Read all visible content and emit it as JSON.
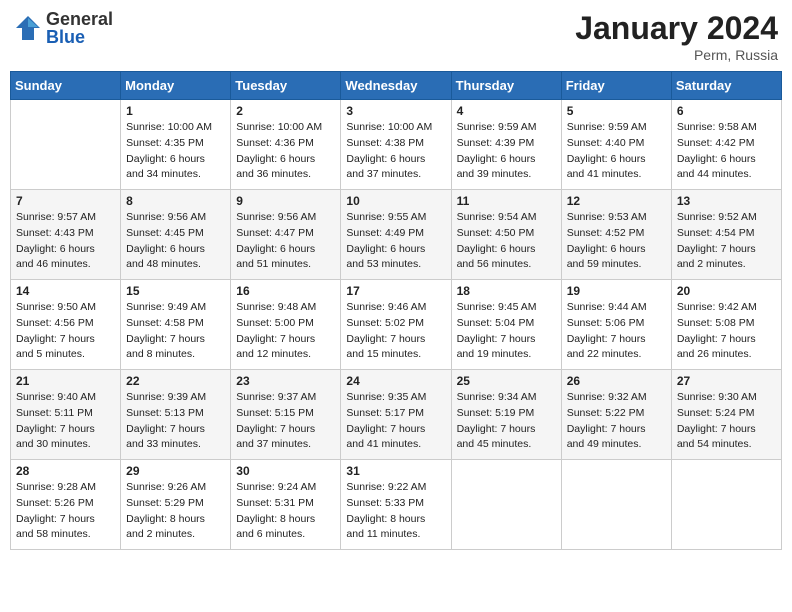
{
  "header": {
    "logo_general": "General",
    "logo_blue": "Blue",
    "title": "January 2024",
    "location": "Perm, Russia"
  },
  "days_of_week": [
    "Sunday",
    "Monday",
    "Tuesday",
    "Wednesday",
    "Thursday",
    "Friday",
    "Saturday"
  ],
  "weeks": [
    [
      {
        "day": "",
        "info": ""
      },
      {
        "day": "1",
        "info": "Sunrise: 10:00 AM\nSunset: 4:35 PM\nDaylight: 6 hours\nand 34 minutes."
      },
      {
        "day": "2",
        "info": "Sunrise: 10:00 AM\nSunset: 4:36 PM\nDaylight: 6 hours\nand 36 minutes."
      },
      {
        "day": "3",
        "info": "Sunrise: 10:00 AM\nSunset: 4:38 PM\nDaylight: 6 hours\nand 37 minutes."
      },
      {
        "day": "4",
        "info": "Sunrise: 9:59 AM\nSunset: 4:39 PM\nDaylight: 6 hours\nand 39 minutes."
      },
      {
        "day": "5",
        "info": "Sunrise: 9:59 AM\nSunset: 4:40 PM\nDaylight: 6 hours\nand 41 minutes."
      },
      {
        "day": "6",
        "info": "Sunrise: 9:58 AM\nSunset: 4:42 PM\nDaylight: 6 hours\nand 44 minutes."
      }
    ],
    [
      {
        "day": "7",
        "info": "Sunrise: 9:57 AM\nSunset: 4:43 PM\nDaylight: 6 hours\nand 46 minutes."
      },
      {
        "day": "8",
        "info": "Sunrise: 9:56 AM\nSunset: 4:45 PM\nDaylight: 6 hours\nand 48 minutes."
      },
      {
        "day": "9",
        "info": "Sunrise: 9:56 AM\nSunset: 4:47 PM\nDaylight: 6 hours\nand 51 minutes."
      },
      {
        "day": "10",
        "info": "Sunrise: 9:55 AM\nSunset: 4:49 PM\nDaylight: 6 hours\nand 53 minutes."
      },
      {
        "day": "11",
        "info": "Sunrise: 9:54 AM\nSunset: 4:50 PM\nDaylight: 6 hours\nand 56 minutes."
      },
      {
        "day": "12",
        "info": "Sunrise: 9:53 AM\nSunset: 4:52 PM\nDaylight: 6 hours\nand 59 minutes."
      },
      {
        "day": "13",
        "info": "Sunrise: 9:52 AM\nSunset: 4:54 PM\nDaylight: 7 hours\nand 2 minutes."
      }
    ],
    [
      {
        "day": "14",
        "info": "Sunrise: 9:50 AM\nSunset: 4:56 PM\nDaylight: 7 hours\nand 5 minutes."
      },
      {
        "day": "15",
        "info": "Sunrise: 9:49 AM\nSunset: 4:58 PM\nDaylight: 7 hours\nand 8 minutes."
      },
      {
        "day": "16",
        "info": "Sunrise: 9:48 AM\nSunset: 5:00 PM\nDaylight: 7 hours\nand 12 minutes."
      },
      {
        "day": "17",
        "info": "Sunrise: 9:46 AM\nSunset: 5:02 PM\nDaylight: 7 hours\nand 15 minutes."
      },
      {
        "day": "18",
        "info": "Sunrise: 9:45 AM\nSunset: 5:04 PM\nDaylight: 7 hours\nand 19 minutes."
      },
      {
        "day": "19",
        "info": "Sunrise: 9:44 AM\nSunset: 5:06 PM\nDaylight: 7 hours\nand 22 minutes."
      },
      {
        "day": "20",
        "info": "Sunrise: 9:42 AM\nSunset: 5:08 PM\nDaylight: 7 hours\nand 26 minutes."
      }
    ],
    [
      {
        "day": "21",
        "info": "Sunrise: 9:40 AM\nSunset: 5:11 PM\nDaylight: 7 hours\nand 30 minutes."
      },
      {
        "day": "22",
        "info": "Sunrise: 9:39 AM\nSunset: 5:13 PM\nDaylight: 7 hours\nand 33 minutes."
      },
      {
        "day": "23",
        "info": "Sunrise: 9:37 AM\nSunset: 5:15 PM\nDaylight: 7 hours\nand 37 minutes."
      },
      {
        "day": "24",
        "info": "Sunrise: 9:35 AM\nSunset: 5:17 PM\nDaylight: 7 hours\nand 41 minutes."
      },
      {
        "day": "25",
        "info": "Sunrise: 9:34 AM\nSunset: 5:19 PM\nDaylight: 7 hours\nand 45 minutes."
      },
      {
        "day": "26",
        "info": "Sunrise: 9:32 AM\nSunset: 5:22 PM\nDaylight: 7 hours\nand 49 minutes."
      },
      {
        "day": "27",
        "info": "Sunrise: 9:30 AM\nSunset: 5:24 PM\nDaylight: 7 hours\nand 54 minutes."
      }
    ],
    [
      {
        "day": "28",
        "info": "Sunrise: 9:28 AM\nSunset: 5:26 PM\nDaylight: 7 hours\nand 58 minutes."
      },
      {
        "day": "29",
        "info": "Sunrise: 9:26 AM\nSunset: 5:29 PM\nDaylight: 8 hours\nand 2 minutes."
      },
      {
        "day": "30",
        "info": "Sunrise: 9:24 AM\nSunset: 5:31 PM\nDaylight: 8 hours\nand 6 minutes."
      },
      {
        "day": "31",
        "info": "Sunrise: 9:22 AM\nSunset: 5:33 PM\nDaylight: 8 hours\nand 11 minutes."
      },
      {
        "day": "",
        "info": ""
      },
      {
        "day": "",
        "info": ""
      },
      {
        "day": "",
        "info": ""
      }
    ]
  ]
}
